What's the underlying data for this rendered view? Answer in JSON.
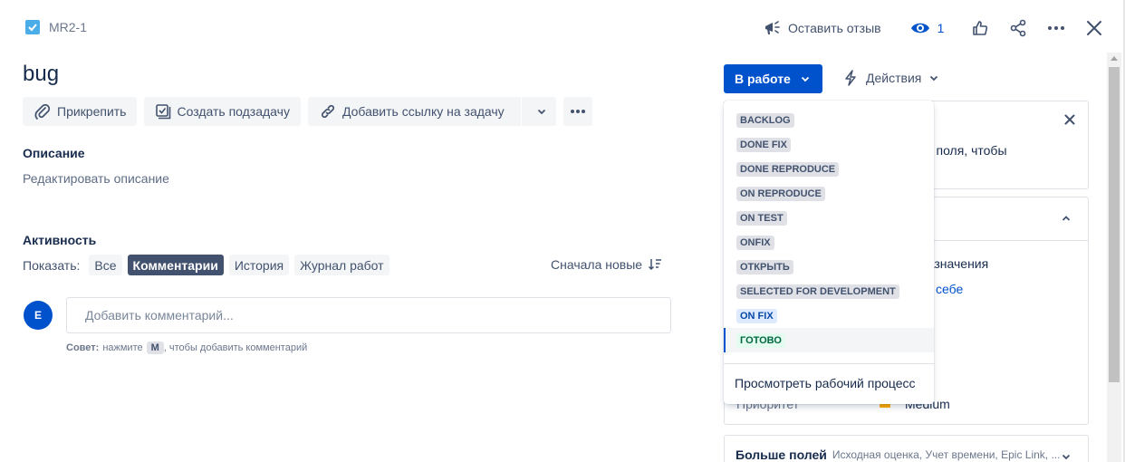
{
  "header": {
    "issue_key": "MR2-1",
    "feedback_label": "Оставить отзыв",
    "watch_count": "1"
  },
  "issue": {
    "title": "bug"
  },
  "toolbar": {
    "attach_label": "Прикрепить",
    "subtask_label": "Создать подзадачу",
    "link_label": "Добавить ссылку на задачу"
  },
  "description": {
    "label": "Описание",
    "placeholder": "Редактировать описание"
  },
  "activity": {
    "label": "Активность",
    "show_label": "Показать:",
    "filters": [
      "Все",
      "Комментарии",
      "История",
      "Журнал работ"
    ],
    "active_filter": "Комментарии",
    "sort_label": "Сначала новые",
    "avatar_initial": "E",
    "comment_placeholder": "Добавить комментарий...",
    "tip_prefix": "Совет:",
    "tip_text1": "нажмите",
    "tip_key": "M",
    "tip_text2": ", чтобы добавить комментарий"
  },
  "status": {
    "current": "В работе",
    "actions_label": "Действия",
    "options": [
      {
        "label": "BACKLOG",
        "color": "#42526E"
      },
      {
        "label": "DONE FIX",
        "color": "#42526E"
      },
      {
        "label": "DONE REPRODUCE",
        "color": "#42526E"
      },
      {
        "label": "ON REPRODUCE",
        "color": "#42526E"
      },
      {
        "label": "ON TEST",
        "color": "#42526E"
      },
      {
        "label": "ONFIX",
        "color": "#42526E"
      },
      {
        "label": "ОТКРЫТЬ",
        "color": "#42526E"
      },
      {
        "label": "SELECTED FOR DEVELOPMENT",
        "color": "#42526E"
      },
      {
        "label": "ON FIX",
        "color": "#0747A6"
      },
      {
        "label": "ГОТОВО",
        "color": "#006644"
      }
    ],
    "hovered_option": "ГОТОВО",
    "view_workflow_label": "Просмотреть рабочий процесс"
  },
  "side": {
    "panel1_text": "ой поля, чтобы",
    "panel2_text": "назначения",
    "assign_self": "себе",
    "priority_label": "Приоритет",
    "priority_value": "Medium",
    "more_fields_title": "Больше полей",
    "more_fields_sub": "Исходная оценка, Учет времени, Epic Link, ..."
  },
  "colors": {
    "primary": "#0052CC",
    "text": "#172B4D",
    "subtle": "#42526E",
    "button_bg": "#F4F5F7"
  }
}
